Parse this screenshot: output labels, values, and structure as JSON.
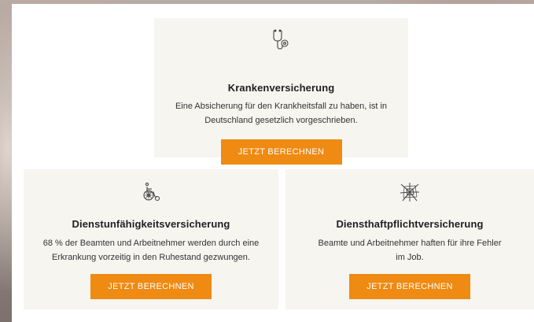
{
  "cards": [
    {
      "icon": "stethoscope-icon",
      "title": "Krankenversicherung",
      "text_line1": "Eine Absicherung für den Krankheitsfall zu haben, ist in",
      "text_line2": "Deutschland gesetzlich vorgeschrieben.",
      "button": "JETZT BERECHNEN"
    },
    {
      "icon": "wheelchair-icon",
      "title": "Dienstunfähigkeitsversicherung",
      "text_line1": "68 % der Beamten und Arbeitnehmer werden durch eine",
      "text_line2": "Erkrankung vorzeitig in den Ruhestand gezwungen.",
      "button": "JETZT BERECHNEN"
    },
    {
      "icon": "broken-glass-icon",
      "title": "Diensthaftpflichtversicherung",
      "text_line1": "Beamte und Arbeitnehmer haften für ihre Fehler",
      "text_line2": "im Job.",
      "button": "JETZT BERECHNEN"
    }
  ],
  "colors": {
    "accent": "#ef8a12",
    "card_background": "#f6f5f0",
    "panel_background": "#ffffff"
  }
}
